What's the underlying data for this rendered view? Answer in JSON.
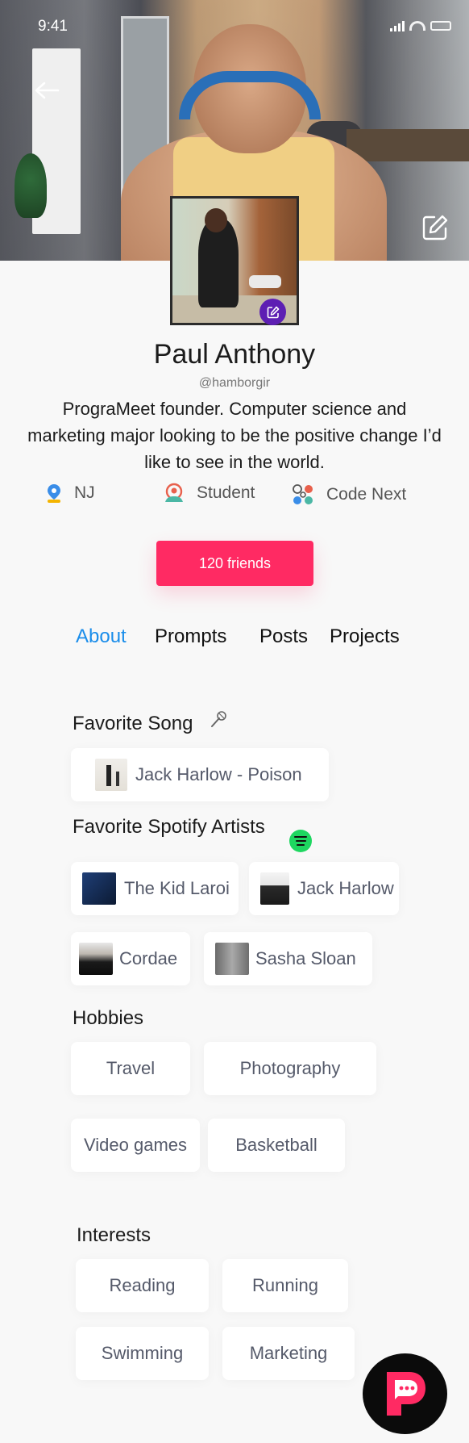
{
  "status_bar": {
    "time": "9:41"
  },
  "profile": {
    "name": "Paul Anthony",
    "handle": "@hamborgir",
    "bio": "PrograMeet founder. Computer science and marketing major looking to be the positive change I’d like to see in the world.",
    "location": "NJ",
    "role": "Student",
    "organization": "Code Next",
    "friends_label": "120 friends"
  },
  "tabs": [
    {
      "label": "About",
      "active": true
    },
    {
      "label": "Prompts",
      "active": false
    },
    {
      "label": "Posts",
      "active": false
    },
    {
      "label": "Projects",
      "active": false
    }
  ],
  "favorite_song": {
    "title": "Favorite Song",
    "song": "Jack Harlow - Poison"
  },
  "favorite_artists": {
    "title": "Favorite Spotify Artists",
    "artists": [
      "The Kid Laroi",
      "Jack Harlow",
      "Cordae",
      "Sasha Sloan"
    ]
  },
  "hobbies": {
    "title": "Hobbies",
    "items": [
      "Travel",
      "Photography",
      "Video games",
      "Basketball"
    ]
  },
  "interests": {
    "title": "Interests",
    "items": [
      "Reading",
      "Running",
      "Swimming",
      "Marketing"
    ]
  },
  "colors": {
    "accent_tab": "#1a8dea",
    "friends_button": "#ff2a63",
    "avatar_edit": "#5d1fb3",
    "spotify": "#1ed760"
  },
  "icons": {
    "back": "arrow-left-icon",
    "edit_cover": "edit-square-icon",
    "edit_avatar": "edit-square-icon",
    "location": "location-pin-icon",
    "role": "student-icon",
    "organization": "org-nodes-icon",
    "song": "microphone-icon",
    "spotify": "spotify-icon",
    "app": "programeet-logo-icon"
  }
}
